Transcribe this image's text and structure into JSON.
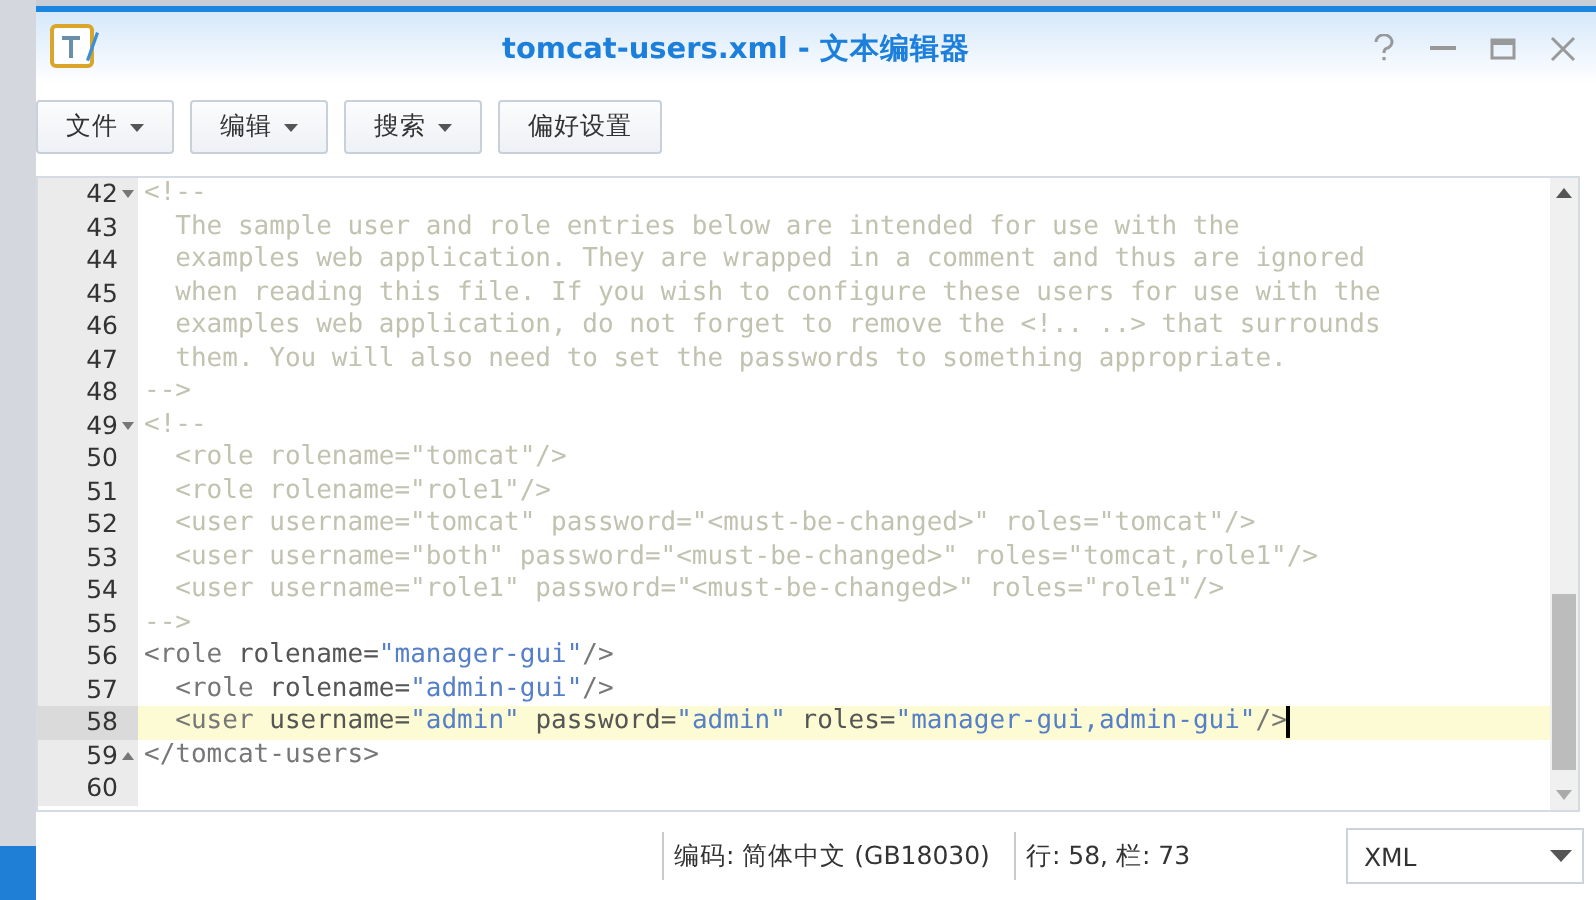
{
  "window": {
    "title": "tomcat-users.xml - 文本编辑器"
  },
  "toolbar": [
    {
      "label": "文件",
      "kind": "menu"
    },
    {
      "label": "编辑",
      "kind": "menu"
    },
    {
      "label": "搜索",
      "kind": "menu"
    },
    {
      "label": "偏好设置",
      "kind": "button"
    }
  ],
  "editor": {
    "lines": [
      {
        "number": "42",
        "fold_start": true,
        "current": false,
        "tokens": [
          {
            "kind": "comment",
            "text": "<!--"
          }
        ]
      },
      {
        "number": "43",
        "current": false,
        "tokens": [
          {
            "kind": "comment",
            "text": "  The sample user and role entries below are intended for use with the"
          }
        ]
      },
      {
        "number": "44",
        "current": false,
        "tokens": [
          {
            "kind": "comment",
            "text": "  examples web application. They are wrapped in a comment and thus are ignored"
          }
        ]
      },
      {
        "number": "45",
        "current": false,
        "tokens": [
          {
            "kind": "comment",
            "text": "  when reading this file. If you wish to configure these users for use with the"
          }
        ]
      },
      {
        "number": "46",
        "current": false,
        "tokens": [
          {
            "kind": "comment",
            "text": "  examples web application, do not forget to remove the <!.. ..> that surrounds"
          }
        ]
      },
      {
        "number": "47",
        "current": false,
        "tokens": [
          {
            "kind": "comment",
            "text": "  them. You will also need to set the passwords to something appropriate."
          }
        ]
      },
      {
        "number": "48",
        "current": false,
        "tokens": [
          {
            "kind": "comment",
            "text": "-->"
          }
        ]
      },
      {
        "number": "49",
        "fold_start": true,
        "current": false,
        "tokens": [
          {
            "kind": "comment",
            "text": "<!--"
          }
        ]
      },
      {
        "number": "50",
        "current": false,
        "tokens": [
          {
            "kind": "comment",
            "text": "  <role rolename=\"tomcat\"/>"
          }
        ]
      },
      {
        "number": "51",
        "current": false,
        "tokens": [
          {
            "kind": "comment",
            "text": "  <role rolename=\"role1\"/>"
          }
        ]
      },
      {
        "number": "52",
        "current": false,
        "tokens": [
          {
            "kind": "comment",
            "text": "  <user username=\"tomcat\" password=\"<must-be-changed>\" roles=\"tomcat\"/>"
          }
        ]
      },
      {
        "number": "53",
        "current": false,
        "tokens": [
          {
            "kind": "comment",
            "text": "  <user username=\"both\" password=\"<must-be-changed>\" roles=\"tomcat,role1\"/>"
          }
        ]
      },
      {
        "number": "54",
        "current": false,
        "tokens": [
          {
            "kind": "comment",
            "text": "  <user username=\"role1\" password=\"<must-be-changed>\" roles=\"role1\"/>"
          }
        ]
      },
      {
        "number": "55",
        "current": false,
        "tokens": [
          {
            "kind": "comment",
            "text": "-->"
          }
        ]
      },
      {
        "number": "56",
        "current": false,
        "tokens": [
          {
            "kind": "tag",
            "text": "<role"
          },
          {
            "kind": "attr",
            "text": " rolename="
          },
          {
            "kind": "string",
            "text": "\"manager-gui\""
          },
          {
            "kind": "tag",
            "text": "/>"
          }
        ]
      },
      {
        "number": "57",
        "current": false,
        "tokens": [
          {
            "kind": "tag",
            "text": "  <role"
          },
          {
            "kind": "attr",
            "text": " rolename="
          },
          {
            "kind": "string",
            "text": "\"admin-gui\""
          },
          {
            "kind": "tag",
            "text": "/>"
          }
        ]
      },
      {
        "number": "58",
        "current": true,
        "tokens": [
          {
            "kind": "tag",
            "text": "  <user"
          },
          {
            "kind": "attr",
            "text": " username="
          },
          {
            "kind": "string",
            "text": "\"admin\""
          },
          {
            "kind": "attr",
            "text": " password="
          },
          {
            "kind": "string",
            "text": "\"admin\""
          },
          {
            "kind": "attr",
            "text": " roles="
          },
          {
            "kind": "string",
            "text": "\"manager-gui,admin-gui\""
          },
          {
            "kind": "tag",
            "text": "/>"
          }
        ]
      },
      {
        "number": "59",
        "fold_end": true,
        "current": false,
        "tokens": [
          {
            "kind": "tag",
            "text": "</tomcat-users>"
          }
        ]
      },
      {
        "number": "60",
        "current": false
      }
    ]
  },
  "status_bar": {
    "encoding": "编码: 简体中文 (GB18030)",
    "position": "行: 58, 栏: 73",
    "language": "XML"
  }
}
